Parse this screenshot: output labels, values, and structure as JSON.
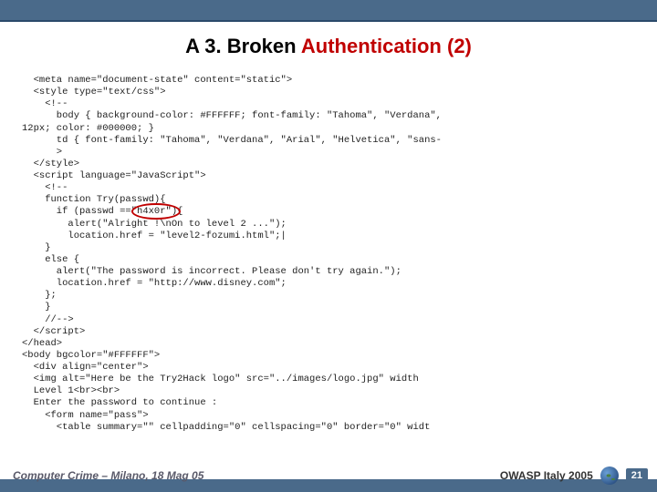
{
  "title": {
    "prefix": "A 3. Broken ",
    "word1": "Authentication",
    "suffix": " (2)"
  },
  "code_lines": [
    "  <meta name=\"document-state\" content=\"static\">",
    "  <style type=\"text/css\">",
    "    <!--",
    "      body { background-color: #FFFFFF; font-family: \"Tahoma\", \"Verdana\",",
    "12px; color: #000000; }",
    "      td { font-family: \"Tahoma\", \"Verdana\", \"Arial\", \"Helvetica\", \"sans-",
    "      >",
    "  </style>",
    "  <script language=\"JavaScript\">",
    "    <!--",
    "    function Try(passwd){",
    "      if (passwd ==\"h4x0r\"){",
    "        alert(\"Alright !\\nOn to level 2 ...\");",
    "        location.href = \"level2-fozumi.html\";|",
    "    }",
    "    else {",
    "      alert(\"The password is incorrect. Please don't try again.\");",
    "      location.href = \"http://www.disney.com\";",
    "    };",
    "",
    "    }",
    "    //-->",
    "  </script>",
    "</head>",
    "<body bgcolor=\"#FFFFFF\">",
    "  <div align=\"center\">",
    "  <img alt=\"Here be the Try2Hack logo\" src=\"../images/logo.jpg\" width",
    "  Level 1<br><br>",
    "  Enter the password to continue :",
    "    <form name=\"pass\">",
    "      <table summary=\"\" cellpadding=\"0\" cellspacing=\"0\" border=\"0\" widt"
  ],
  "highlight_value": "h4x0r",
  "footer": {
    "left": "Computer Crime – Milano, 18 Mag 05",
    "right": "OWASP Italy 2005",
    "page": "21"
  }
}
